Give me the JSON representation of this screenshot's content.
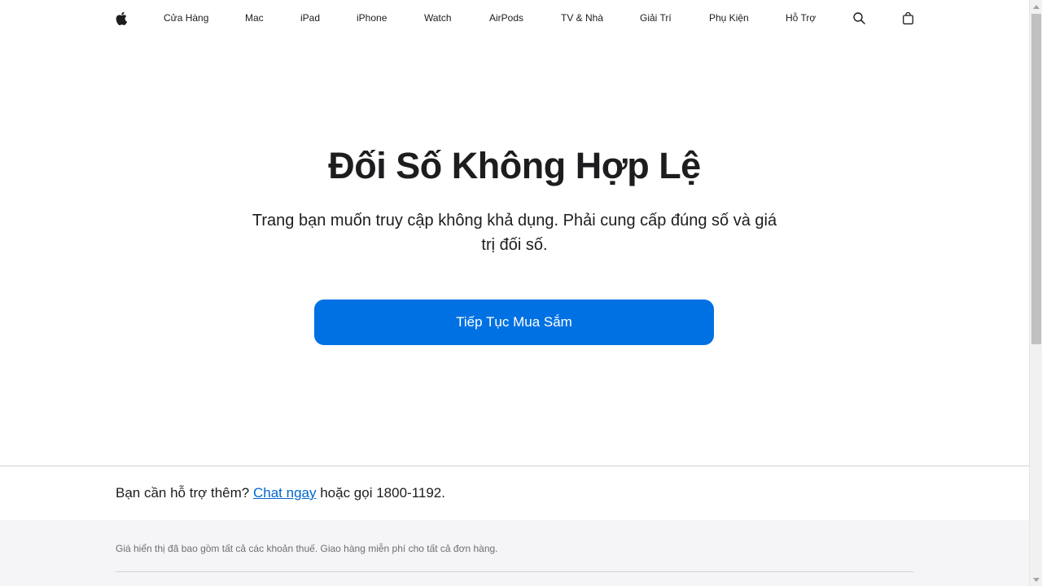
{
  "nav": {
    "logo_icon": "apple-logo-icon",
    "items": [
      {
        "label": "Cửa Hàng"
      },
      {
        "label": "Mac"
      },
      {
        "label": "iPad"
      },
      {
        "label": "iPhone"
      },
      {
        "label": "Watch"
      },
      {
        "label": "AirPods"
      },
      {
        "label": "TV & Nhà"
      },
      {
        "label": "Giải Trí"
      },
      {
        "label": "Phụ Kiện"
      },
      {
        "label": "Hỗ Trợ"
      }
    ],
    "search_icon": "search-icon",
    "bag_icon": "shopping-bag-icon"
  },
  "main": {
    "title": "Đối Số Không Hợp Lệ",
    "description": "Trang bạn muốn truy cập không khả dụng. Phải cung cấp đúng số và giá trị đối số.",
    "cta_label": "Tiếp Tục Mua Sắm"
  },
  "help": {
    "prefix": "Bạn cần hỗ trợ thêm?",
    "link_label": "Chat ngay",
    "suffix": "hoặc gọi 1800-1192."
  },
  "footer": {
    "footnote": "Giá hiển thị đã bao gồm tất cả các khoản thuế. Giao hàng miễn phí cho tất cả đơn hàng."
  },
  "colors": {
    "accent": "#0071e3",
    "link": "#0066cc",
    "text": "#1d1d1f",
    "footer_bg": "#f5f5f7"
  }
}
